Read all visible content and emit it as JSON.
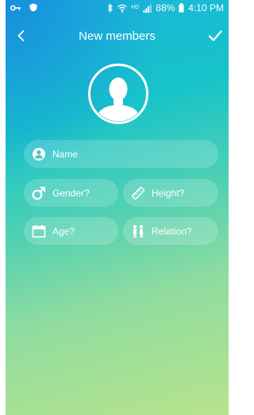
{
  "status_bar": {
    "network_label": "HD",
    "battery": "88%",
    "time": "4:10 PM"
  },
  "header": {
    "title": "New members"
  },
  "form": {
    "name_placeholder": "Name",
    "gender_placeholder": "Gender?",
    "height_placeholder": "Height?",
    "age_placeholder": "Age?",
    "relation_placeholder": "Relation?"
  },
  "colors": {
    "gradient_top": "#1bb6de",
    "gradient_bottom": "#b7e38c",
    "text": "#ffffff"
  },
  "icons": {
    "back": "back-arrow-icon",
    "confirm": "check-icon",
    "avatar": "person-silhouette-icon",
    "name": "person-circle-icon",
    "gender": "male-symbol-icon",
    "height": "ruler-icon",
    "age": "calendar-icon",
    "relation": "family-icon"
  }
}
